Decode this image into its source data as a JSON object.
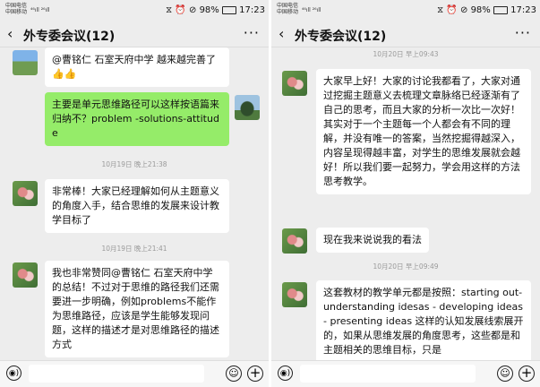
{
  "left": {
    "status": {
      "carrier1": "中国电信",
      "carrier2": "中国移动",
      "signal": "⁴⁶ıll ²⁶ıll",
      "battery": "98%",
      "time": "17:23"
    },
    "title": "外专委会议(12)",
    "messages": [
      {
        "text": "@曹铭仁 石室天府中学  越来越完善了👍👍"
      },
      {
        "text": "主要是单元思维路径可以这样按语篇来归纳不？problem -solutions-attitude"
      },
      {
        "time": "10月19日 晚上21:38"
      },
      {
        "text": "非常棒！大家已经理解如何从主题意义的角度入手，结合思维的发展来设计教学目标了"
      },
      {
        "time": "10月19日 晚上21:41"
      },
      {
        "text": "我也非常赞同@曹铭仁 石室天府中学 的总结！不过对于思维的路径我们还需要进一步明确，例如problems不能作为思维路径，应该是学生能够发现问题，这样的描述才是对思维路径的描述方式"
      }
    ]
  },
  "right": {
    "status": {
      "carrier1": "中国电信",
      "carrier2": "中国移动",
      "signal": "⁴⁶ıll ²⁶ıll",
      "battery": "98%",
      "time": "17:23"
    },
    "title": "外专委会议(12)",
    "messages": [
      {
        "time": "10月20日 早上09:43"
      },
      {
        "text": "大家早上好！大家的讨论我都看了，大家对通过挖掘主题意义去梳理文章脉络已经逐渐有了自己的思考，而且大家的分析一次比一次好！其实对于一个主题每一个人都会有不同的理解，并没有唯一的答案，当然挖掘得越深入，内容呈现得越丰富，对学生的思维发展就会越好！所以我们要一起努力，学会用这样的方法思考教学。"
      },
      {
        "text": "现在我来说说我的看法"
      },
      {
        "time": "10月20日 早上09:49"
      },
      {
        "text": "这套教材的教学单元都是按照：starting out-understanding idesas - developing ideas - presenting ideas 这样的认知发展线索展开的，如果从思维发展的角度思考，这些都是和主题相关的思维目标，只是"
      }
    ]
  },
  "icons": {
    "back": "‹",
    "more": "···",
    "voice": "◉)",
    "emoji": "☺",
    "plus": "+"
  },
  "colors": {
    "bg": "#ededed",
    "green": "#95ec69"
  }
}
